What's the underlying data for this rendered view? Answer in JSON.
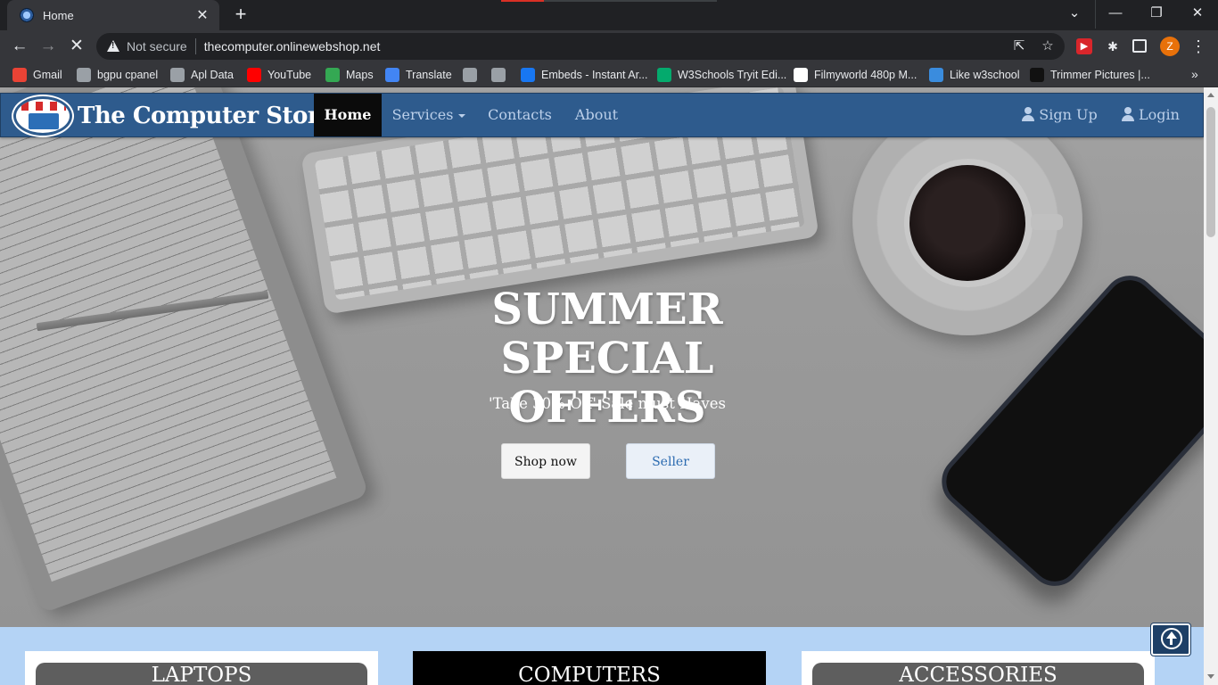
{
  "browser": {
    "tab_title": "Home",
    "tab_close": "✕",
    "new_tab": "+",
    "window_controls": {
      "dropdown": "⌄",
      "minimize": "—",
      "restore": "❐",
      "close": "✕"
    },
    "security_label": "Not secure",
    "url": "thecomputer.onlinewebshop.net",
    "profile_initial": "Z",
    "bookmarks": [
      {
        "label": "Gmail",
        "icon": "gmail-icon",
        "color": "#ea4335"
      },
      {
        "label": "bgpu cpanel",
        "icon": "cpanel-icon",
        "color": "#9aa0a6"
      },
      {
        "label": "Apl Data",
        "icon": "globe-icon",
        "color": "#9aa0a6"
      },
      {
        "label": "YouTube",
        "icon": "youtube-icon",
        "color": "#ff0000"
      },
      {
        "label": "Maps",
        "icon": "maps-icon",
        "color": "#34a853"
      },
      {
        "label": "Translate",
        "icon": "translate-icon",
        "color": "#4285f4"
      },
      {
        "label": "",
        "icon": "globe-icon",
        "color": "#9aa0a6"
      },
      {
        "label": "",
        "icon": "globe-icon",
        "color": "#9aa0a6"
      },
      {
        "label": "Embeds - Instant Ar...",
        "icon": "facebook-icon",
        "color": "#1877f2"
      },
      {
        "label": "W3Schools Tryit Edi...",
        "icon": "w3schools-icon",
        "color": "#04aa6d"
      },
      {
        "label": "Filmyworld 480p M...",
        "icon": "filmyworld-icon",
        "color": "#ffffff"
      },
      {
        "label": "Like w3school",
        "icon": "w3-icon",
        "color": "#3a8cde"
      },
      {
        "label": "Trimmer Pictures |...",
        "icon": "trimmer-icon",
        "color": "#111111"
      }
    ],
    "bookmarks_more": "»"
  },
  "site": {
    "brand_name": "The Computer Store",
    "nav": [
      {
        "label": "Home",
        "active": true
      },
      {
        "label": "Services",
        "dropdown": true
      },
      {
        "label": "Contacts"
      },
      {
        "label": "About"
      }
    ],
    "nav_right": {
      "signup": "Sign Up",
      "login": "Login"
    },
    "hero": {
      "title_line1": "SUMMER SPECIAL",
      "title_line2": "OFFERS",
      "subtitle": "'Take 30% Off' Sale must Haves",
      "shop_button": "Shop now",
      "seller_button": "Seller"
    },
    "categories": [
      "LAPTOPS",
      "COMPUTERS",
      "ACCESSORIES"
    ],
    "colors": {
      "navbar": "#2e5b8d",
      "nav_active": "#0b0b0b",
      "categories_bg": "#b4d3f5",
      "seller_text": "#2a6ab0"
    }
  }
}
